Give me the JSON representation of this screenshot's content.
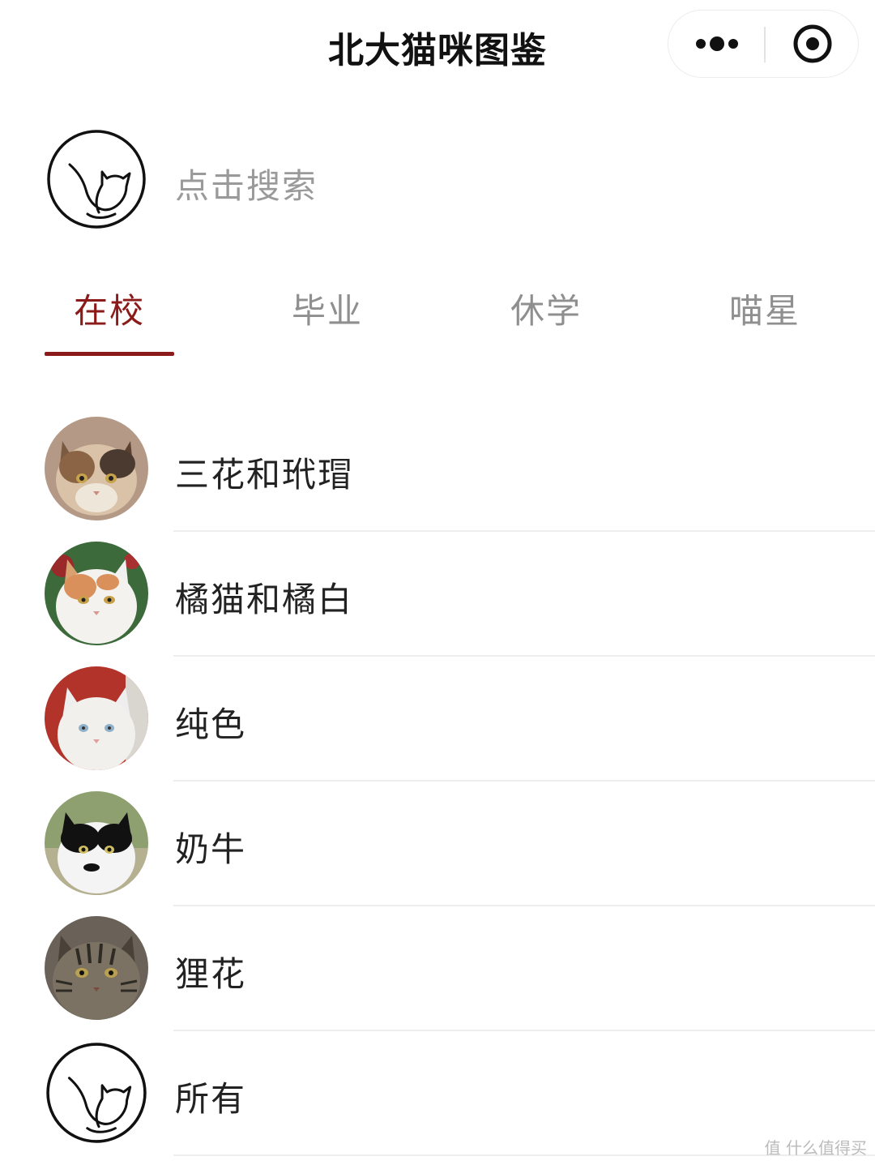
{
  "app": {
    "title": "北大猫咪图鉴"
  },
  "capsule": {
    "more_icon": "more-dots-icon",
    "close_icon": "target-circle-icon"
  },
  "search": {
    "logo_icon": "cat-outline-logo-icon",
    "placeholder": "点击搜索"
  },
  "tabs": [
    {
      "label": "在校",
      "active": true
    },
    {
      "label": "毕业",
      "active": false
    },
    {
      "label": "休学",
      "active": false
    },
    {
      "label": "喵星",
      "active": false
    }
  ],
  "categories": [
    {
      "label": "三花和玳瑁",
      "avatar": "calico-cat-photo"
    },
    {
      "label": "橘猫和橘白",
      "avatar": "orange-white-cat-photo"
    },
    {
      "label": "纯色",
      "avatar": "white-cat-photo"
    },
    {
      "label": "奶牛",
      "avatar": "black-white-cat-photo"
    },
    {
      "label": "狸花",
      "avatar": "tabby-cat-photo"
    },
    {
      "label": "所有",
      "avatar": "cat-outline-logo-icon"
    }
  ],
  "watermark": {
    "text": "值 什么值得买"
  },
  "colors": {
    "accent": "#8b1a1a",
    "inactive_tab": "#8f8f8f",
    "placeholder": "#9a9a9a"
  }
}
